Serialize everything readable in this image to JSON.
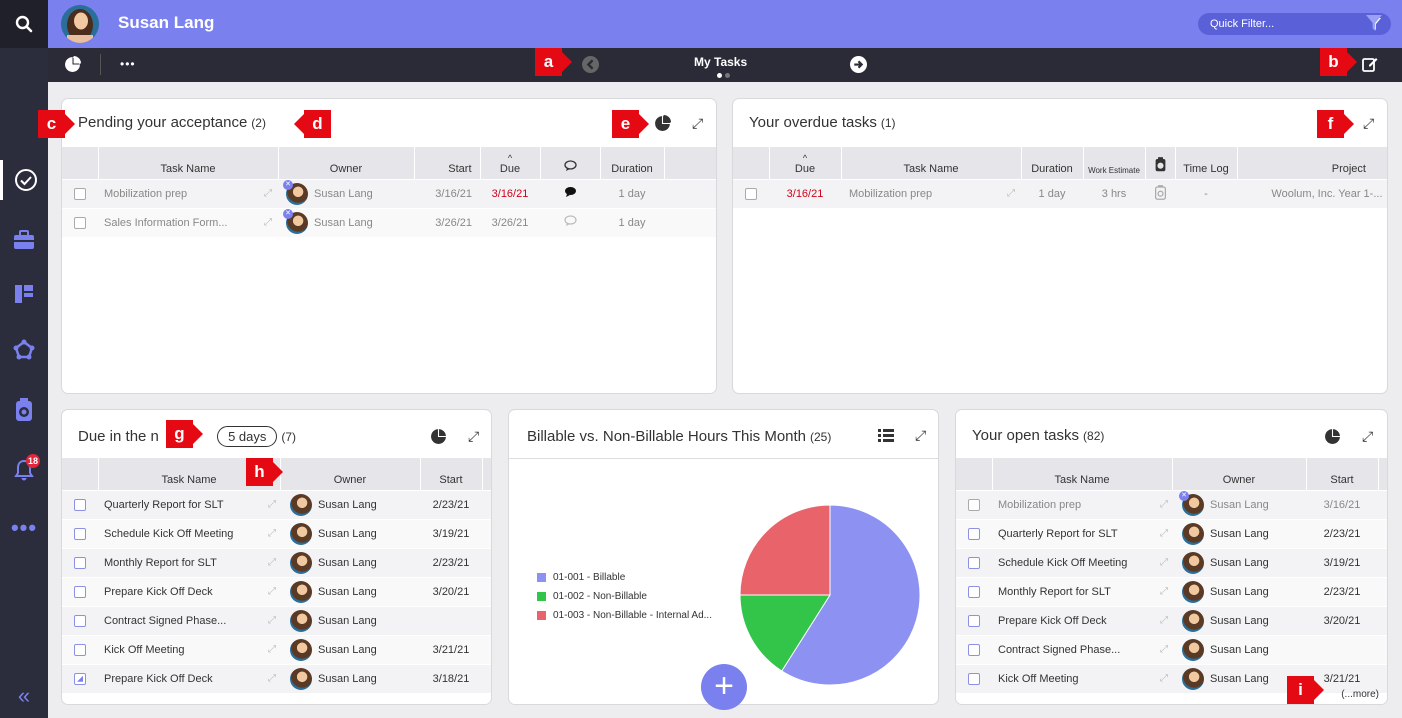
{
  "user": {
    "name": "Susan Lang"
  },
  "topbar": {
    "quick_filter_placeholder": "Quick Filter..."
  },
  "toolbar": {
    "title": "My Tasks"
  },
  "nav": {
    "notifications_badge": "18"
  },
  "pending": {
    "title": "Pending your acceptance",
    "count": "(2)",
    "columns": [
      "Task Name",
      "Owner",
      "Start",
      "Due",
      "Duration"
    ],
    "rows": [
      {
        "task": "Mobilization prep",
        "owner": "Susan Lang",
        "start": "3/16/21",
        "due": "3/16/21",
        "duration": "1 day"
      },
      {
        "task": "Sales Information Form...",
        "owner": "Susan Lang",
        "start": "3/26/21",
        "due": "3/26/21",
        "duration": "1 day"
      }
    ]
  },
  "overdue": {
    "title": "Your overdue tasks",
    "count": "(1)",
    "columns": [
      "Due",
      "Task Name",
      "Duration",
      "Work Estimate",
      "Time Log",
      "Project"
    ],
    "rows": [
      {
        "due": "3/16/21",
        "task": "Mobilization prep",
        "duration": "1 day",
        "work": "3 hrs",
        "timelog": "-",
        "project": "Woolum, Inc. Year 1-..."
      }
    ]
  },
  "due_next": {
    "title": "Due in the n",
    "days": "5 days",
    "count": "(7)",
    "columns": [
      "Task Name",
      "Owner",
      "Start"
    ],
    "rows": [
      {
        "task": "Quarterly Report for SLT",
        "owner": "Susan Lang",
        "start": "2/23/21"
      },
      {
        "task": "Schedule Kick Off Meeting",
        "owner": "Susan Lang",
        "start": "3/19/21"
      },
      {
        "task": "Monthly Report for SLT",
        "owner": "Susan Lang",
        "start": "2/23/21"
      },
      {
        "task": "Prepare Kick Off Deck",
        "owner": "Susan Lang",
        "start": "3/20/21"
      },
      {
        "task": "Contract Signed Phase...",
        "owner": "Susan Lang",
        "start": ""
      },
      {
        "task": "Kick Off Meeting",
        "owner": "Susan Lang",
        "start": "3/21/21"
      },
      {
        "task": "Prepare Kick Off Deck",
        "owner": "Susan Lang",
        "start": "3/18/21"
      }
    ]
  },
  "billable": {
    "title": "Billable vs. Non-Billable Hours This Month",
    "count": "(25)"
  },
  "open_tasks": {
    "title": "Your open tasks",
    "count": "(82)",
    "columns": [
      "Task Name",
      "Owner",
      "Start"
    ],
    "rows": [
      {
        "task": "Mobilization prep",
        "owner": "Susan Lang",
        "start": "3/16/21"
      },
      {
        "task": "Quarterly Report for SLT",
        "owner": "Susan Lang",
        "start": "2/23/21"
      },
      {
        "task": "Schedule Kick Off Meeting",
        "owner": "Susan Lang",
        "start": "3/19/21"
      },
      {
        "task": "Monthly Report for SLT",
        "owner": "Susan Lang",
        "start": "2/23/21"
      },
      {
        "task": "Prepare Kick Off Deck",
        "owner": "Susan Lang",
        "start": "3/20/21"
      },
      {
        "task": "Contract Signed Phase...",
        "owner": "Susan Lang",
        "start": ""
      },
      {
        "task": "Kick Off Meeting",
        "owner": "Susan Lang",
        "start": "3/21/21"
      }
    ],
    "more": "(...more)"
  },
  "markers": {
    "a": "a",
    "b": "b",
    "c": "c",
    "d": "d",
    "e": "e",
    "f": "f",
    "g": "g",
    "h": "h",
    "i": "i"
  },
  "colors": {
    "accent": "#7a80ee",
    "billable": "#8c91f2",
    "non_billable": "#33c44a",
    "internal": "#e8636a",
    "overdue": "#d0021b"
  },
  "chart_data": {
    "type": "pie",
    "categories": [
      "01-001 - Billable",
      "01-002 - Non-Billable",
      "01-003 - Non-Billable - Internal Ad..."
    ],
    "values": [
      59,
      16,
      25
    ],
    "colors": [
      "#8c91f2",
      "#33c44a",
      "#e8636a"
    ],
    "legend": "left"
  }
}
